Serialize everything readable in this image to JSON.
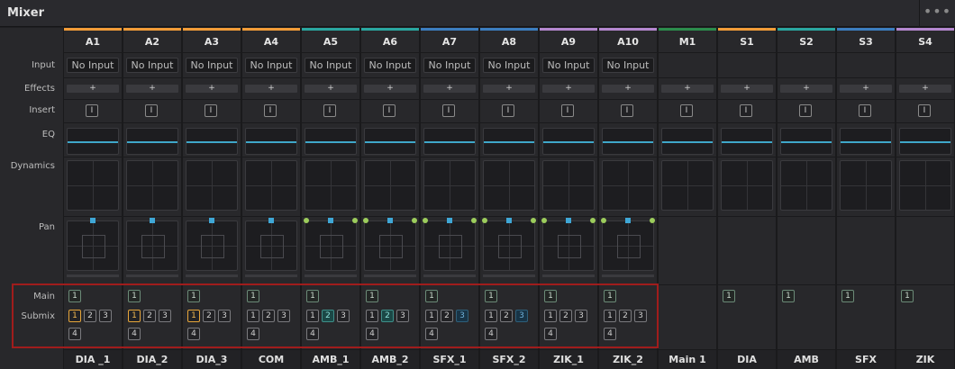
{
  "window": {
    "title": "Mixer",
    "more_icon": "more-horizontal-icon",
    "more_glyph": "•••"
  },
  "row_labels": {
    "input": "Input",
    "effects": "Effects",
    "insert": "Insert",
    "eq": "EQ",
    "dynamics": "Dynamics",
    "pan": "Pan",
    "main": "Main",
    "submix": "Submix"
  },
  "colors": {
    "orange": "#f29c38",
    "teal": "#2aa7a0",
    "blue": "#3c7ec0",
    "purple": "#b487cf",
    "green": "#2c8c4c",
    "highlight": "#a01c1c"
  },
  "strips": [
    {
      "name": "A1",
      "color": "#f29c38",
      "input": "No Input",
      "fx": "+",
      "insert": "I",
      "bottom": "DIA _1",
      "main": "1",
      "submix": [
        "1",
        "2",
        "3",
        "4"
      ],
      "submix_active": "1",
      "submix_style": "orange",
      "pan_style": "center"
    },
    {
      "name": "A2",
      "color": "#f29c38",
      "input": "No Input",
      "fx": "+",
      "insert": "I",
      "bottom": "DIA_2",
      "main": "1",
      "submix": [
        "1",
        "2",
        "3",
        "4"
      ],
      "submix_active": "1",
      "submix_style": "orange",
      "pan_style": "center"
    },
    {
      "name": "A3",
      "color": "#f29c38",
      "input": "No Input",
      "fx": "+",
      "insert": "I",
      "bottom": "DIA_3",
      "main": "1",
      "submix": [
        "1",
        "2",
        "3",
        "4"
      ],
      "submix_active": "1",
      "submix_style": "orange",
      "pan_style": "center"
    },
    {
      "name": "A4",
      "color": "#f29c38",
      "input": "No Input",
      "fx": "+",
      "insert": "I",
      "bottom": "COM",
      "main": "1",
      "submix": [
        "1",
        "2",
        "3",
        "4"
      ],
      "submix_active": "",
      "submix_style": "",
      "pan_style": "center"
    },
    {
      "name": "A5",
      "color": "#2aa7a0",
      "input": "No Input",
      "fx": "+",
      "insert": "I",
      "bottom": "AMB_1",
      "main": "1",
      "submix": [
        "1",
        "2",
        "3",
        "4"
      ],
      "submix_active": "2",
      "submix_style": "teal",
      "pan_style": "stereo"
    },
    {
      "name": "A6",
      "color": "#2aa7a0",
      "input": "No Input",
      "fx": "+",
      "insert": "I",
      "bottom": "AMB_2",
      "main": "1",
      "submix": [
        "1",
        "2",
        "3",
        "4"
      ],
      "submix_active": "2",
      "submix_style": "teal",
      "pan_style": "stereo"
    },
    {
      "name": "A7",
      "color": "#3c7ec0",
      "input": "No Input",
      "fx": "+",
      "insert": "I",
      "bottom": "SFX_1",
      "main": "1",
      "submix": [
        "1",
        "2",
        "3",
        "4"
      ],
      "submix_active": "3",
      "submix_style": "blue",
      "pan_style": "stereo"
    },
    {
      "name": "A8",
      "color": "#3c7ec0",
      "input": "No Input",
      "fx": "+",
      "insert": "I",
      "bottom": "SFX_2",
      "main": "1",
      "submix": [
        "1",
        "2",
        "3",
        "4"
      ],
      "submix_active": "3",
      "submix_style": "blue",
      "pan_style": "stereo"
    },
    {
      "name": "A9",
      "color": "#b487cf",
      "input": "No Input",
      "fx": "+",
      "insert": "I",
      "bottom": "ZIK_1",
      "main": "1",
      "submix": [
        "1",
        "2",
        "3",
        "4"
      ],
      "submix_active": "",
      "submix_style": "",
      "pan_style": "stereo"
    },
    {
      "name": "A10",
      "color": "#b487cf",
      "input": "No Input",
      "fx": "+",
      "insert": "I",
      "bottom": "ZIK_2",
      "main": "1",
      "submix": [
        "1",
        "2",
        "3",
        "4"
      ],
      "submix_active": "",
      "submix_style": "",
      "pan_style": "stereo"
    },
    {
      "name": "M1",
      "color": "#2c8c4c",
      "input": "",
      "fx": "+",
      "insert": "I",
      "bottom": "Main 1",
      "main": "",
      "submix": [],
      "submix_active": "",
      "submix_style": "",
      "pan_style": "none"
    },
    {
      "name": "S1",
      "color": "#f29c38",
      "input": "",
      "fx": "+",
      "insert": "I",
      "bottom": "DIA",
      "main": "1",
      "submix": [],
      "submix_active": "",
      "submix_style": "",
      "pan_style": "none"
    },
    {
      "name": "S2",
      "color": "#2aa7a0",
      "input": "",
      "fx": "+",
      "insert": "I",
      "bottom": "AMB",
      "main": "1",
      "submix": [],
      "submix_active": "",
      "submix_style": "",
      "pan_style": "none"
    },
    {
      "name": "S3",
      "color": "#3c7ec0",
      "input": "",
      "fx": "+",
      "insert": "I",
      "bottom": "SFX",
      "main": "1",
      "submix": [],
      "submix_active": "",
      "submix_style": "",
      "pan_style": "none"
    },
    {
      "name": "S4",
      "color": "#b487cf",
      "input": "",
      "fx": "+",
      "insert": "I",
      "bottom": "ZIK",
      "main": "1",
      "submix": [],
      "submix_active": "",
      "submix_style": "",
      "pan_style": "none"
    }
  ]
}
